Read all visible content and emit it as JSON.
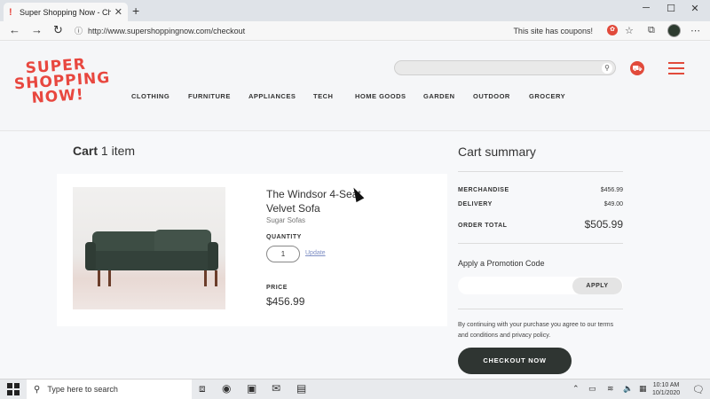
{
  "browser": {
    "tab_title": "Super Shopping Now - Checkout",
    "url": "http://www.supershoppingnow.com/checkout",
    "coupon_text": "This site has coupons!"
  },
  "site": {
    "logo_lines": [
      "SUPER",
      "SHOPPING",
      "NOW!"
    ],
    "nav": [
      "CLOTHING",
      "FURNITURE",
      "APPLIANCES",
      "TECH",
      "HOME GOODS",
      "GARDEN",
      "OUTDOOR",
      "GROCERY"
    ]
  },
  "cart": {
    "title": "Cart",
    "count": "1 item",
    "item": {
      "name": "The Windsor 4-Seat Velvet Sofa",
      "brand": "Sugar Sofas",
      "quantity_label": "QUANTITY",
      "quantity": "1",
      "update_label": "Update",
      "price_label": "PRICE",
      "price": "$456.99"
    }
  },
  "summary": {
    "title": "Cart summary",
    "merchandise_label": "MERCHANDISE",
    "merchandise": "$456.99",
    "delivery_label": "DELIVERY",
    "delivery": "$49.00",
    "total_label": "ORDER TOTAL",
    "total": "$505.99",
    "promo_title": "Apply a Promotion Code",
    "apply_label": "APPLY",
    "terms": "By continuing with your purchase you agree to our terms and conditions and privacy policy.",
    "checkout_label": "CHECKOUT NOW"
  },
  "taskbar": {
    "search_placeholder": "Type here to search",
    "time": "10:10 AM",
    "date": "10/1/2020"
  },
  "colors": {
    "brand_red": "#e8473f",
    "checkout_dark": "#2f3532",
    "link_blue": "#7f8fc4"
  }
}
